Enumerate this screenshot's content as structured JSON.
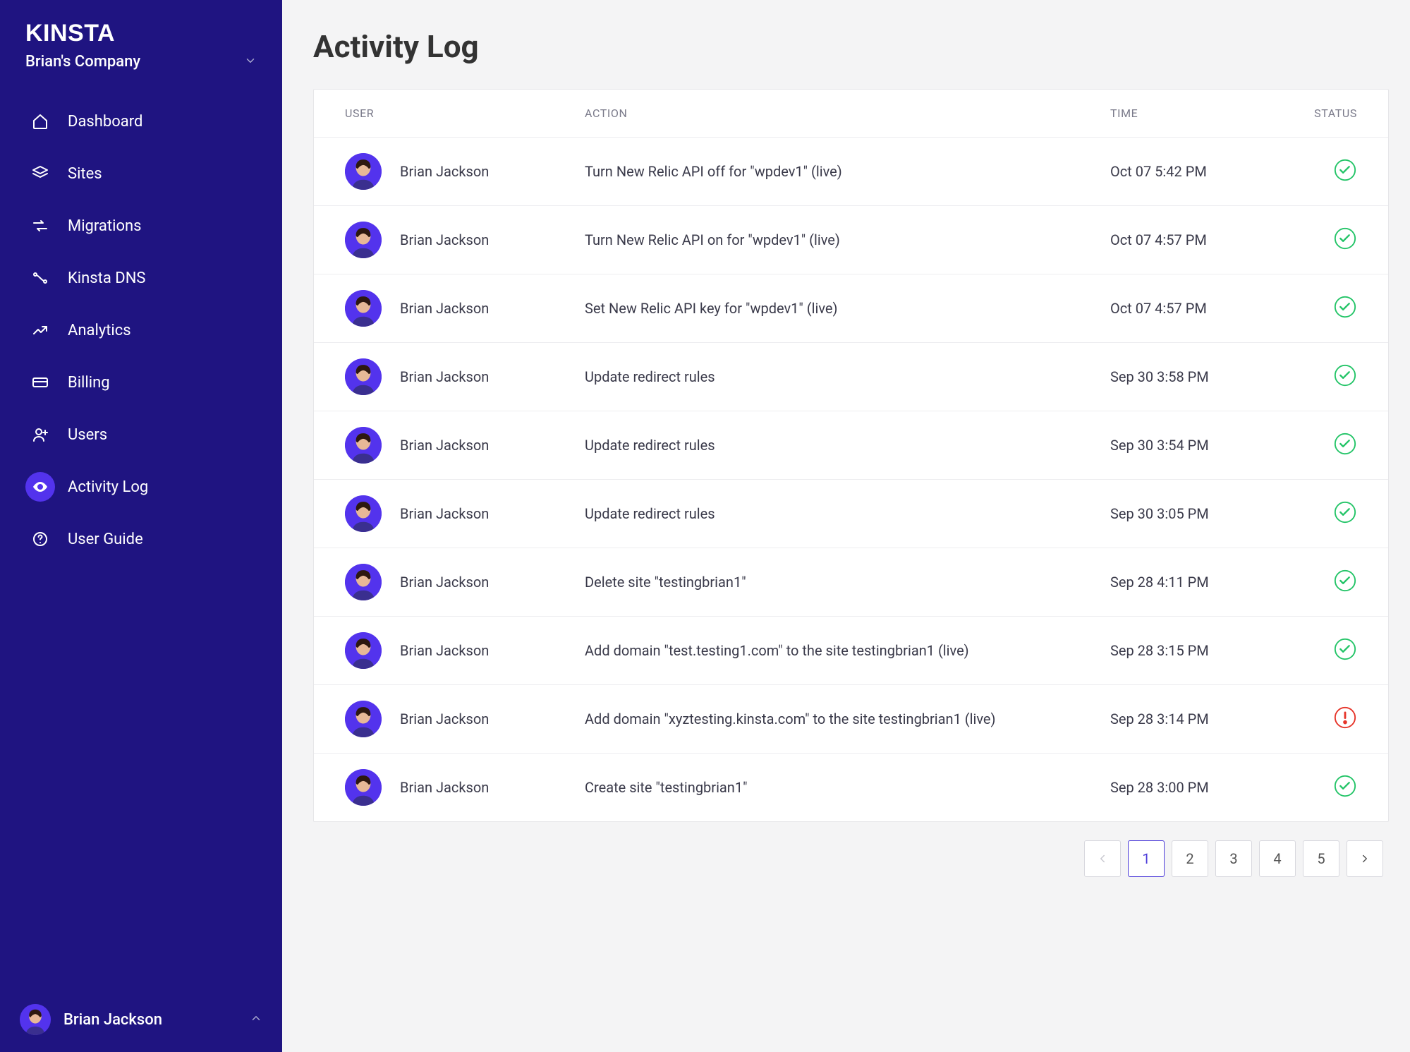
{
  "brand": "KINSTA",
  "company_name": "Brian's Company",
  "current_user": "Brian Jackson",
  "sidebar": {
    "items": [
      {
        "label": "Dashboard"
      },
      {
        "label": "Sites"
      },
      {
        "label": "Migrations"
      },
      {
        "label": "Kinsta DNS"
      },
      {
        "label": "Analytics"
      },
      {
        "label": "Billing"
      },
      {
        "label": "Users"
      },
      {
        "label": "Activity Log"
      },
      {
        "label": "User Guide"
      }
    ]
  },
  "page": {
    "title": "Activity Log",
    "columns": {
      "user": "USER",
      "action": "ACTION",
      "time": "TIME",
      "status": "STATUS"
    }
  },
  "log": [
    {
      "user": "Brian Jackson",
      "action": "Turn New Relic API off for \"wpdev1\" (live)",
      "time": "Oct 07 5:42 PM",
      "status": "ok"
    },
    {
      "user": "Brian Jackson",
      "action": "Turn New Relic API on for \"wpdev1\" (live)",
      "time": "Oct 07 4:57 PM",
      "status": "ok"
    },
    {
      "user": "Brian Jackson",
      "action": "Set New Relic API key for \"wpdev1\" (live)",
      "time": "Oct 07 4:57 PM",
      "status": "ok"
    },
    {
      "user": "Brian Jackson",
      "action": "Update redirect rules",
      "time": "Sep 30 3:58 PM",
      "status": "ok"
    },
    {
      "user": "Brian Jackson",
      "action": "Update redirect rules",
      "time": "Sep 30 3:54 PM",
      "status": "ok"
    },
    {
      "user": "Brian Jackson",
      "action": "Update redirect rules",
      "time": "Sep 30 3:05 PM",
      "status": "ok"
    },
    {
      "user": "Brian Jackson",
      "action": "Delete site \"testingbrian1\"",
      "time": "Sep 28 4:11 PM",
      "status": "ok"
    },
    {
      "user": "Brian Jackson",
      "action": "Add domain \"test.testing1.com\" to the site testingbrian1 (live)",
      "time": "Sep 28 3:15 PM",
      "status": "ok"
    },
    {
      "user": "Brian Jackson",
      "action": "Add domain \"xyztesting.kinsta.com\" to the site testingbrian1 (live)",
      "time": "Sep 28 3:14 PM",
      "status": "err"
    },
    {
      "user": "Brian Jackson",
      "action": "Create site \"testingbrian1\"",
      "time": "Sep 28 3:00 PM",
      "status": "ok"
    }
  ],
  "pagination": {
    "pages": [
      "1",
      "2",
      "3",
      "4",
      "5"
    ],
    "current": "1"
  }
}
